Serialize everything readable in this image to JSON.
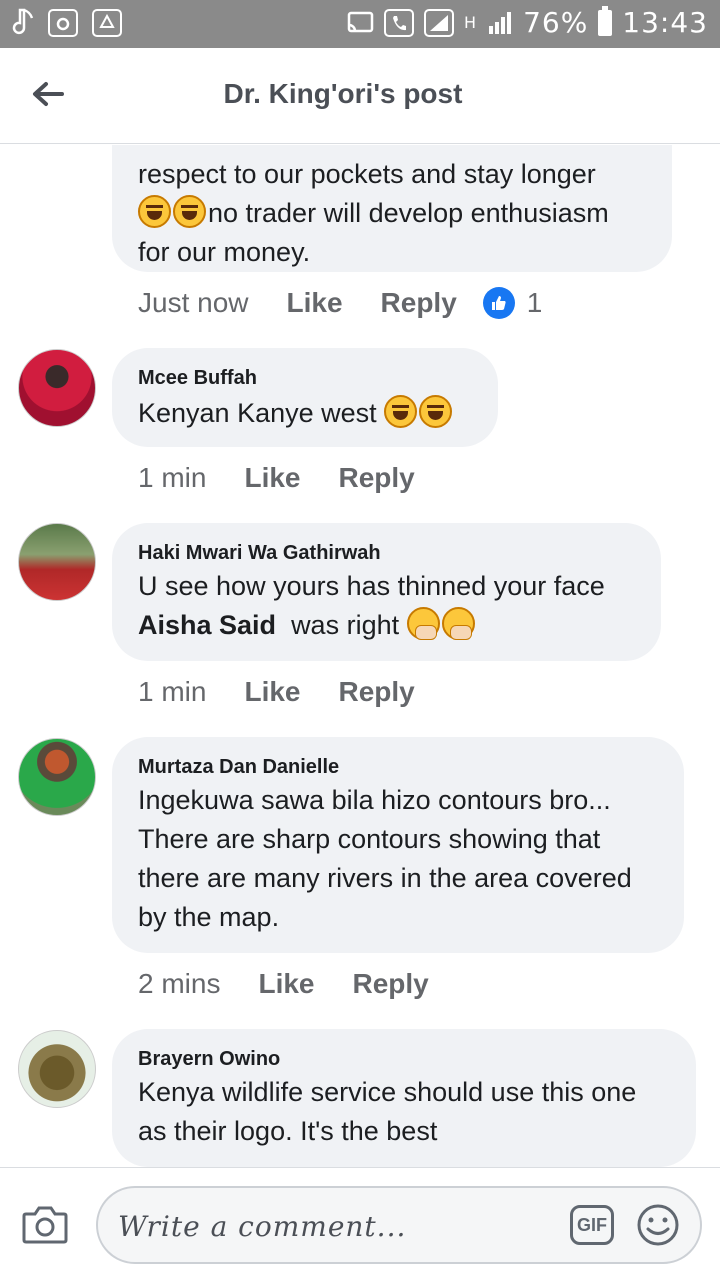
{
  "status_bar": {
    "battery": "76%",
    "time": "13:43",
    "network": "H"
  },
  "header": {
    "title": "Dr. King'ori's post",
    "back_icon": "arrow-left-icon"
  },
  "comments": [
    {
      "author": "",
      "text_lines": [
        "respect to our pockets and stay longer"
      ],
      "text_line2": "no trader will develop enthusiasm",
      "text_line3": "for our money.",
      "time": "Just now",
      "like_label": "Like",
      "reply_label": "Reply",
      "reactions": "1"
    },
    {
      "author": "Mcee Buffah",
      "text": "Kenyan Kanye west",
      "time": "1 min",
      "like_label": "Like",
      "reply_label": "Reply"
    },
    {
      "author": "Haki Mwari Wa Gathirwah",
      "text_line1": "U see how yours has thinned your face",
      "mention": "Aisha Said",
      "text_line2_rest": "was right",
      "time": "1 min",
      "like_label": "Like",
      "reply_label": "Reply"
    },
    {
      "author": "Murtaza Dan Danielle",
      "text_lines": [
        "Ingekuwa sawa bila hizo contours bro...",
        "There are sharp contours showing that",
        "there are many rivers in the area covered",
        "by the map."
      ],
      "time": "2 mins",
      "like_label": "Like",
      "reply_label": "Reply"
    },
    {
      "author": "Brayern Owino",
      "text_lines": [
        "Kenya wildlife service should use this one",
        "as their logo. It's the best"
      ]
    }
  ],
  "composer": {
    "placeholder": "Write a comment...",
    "gif_label": "GIF"
  },
  "colors": {
    "accent": "#1877f2",
    "bubble": "#f0f2f5",
    "status_bar": "#8a8a8a"
  }
}
